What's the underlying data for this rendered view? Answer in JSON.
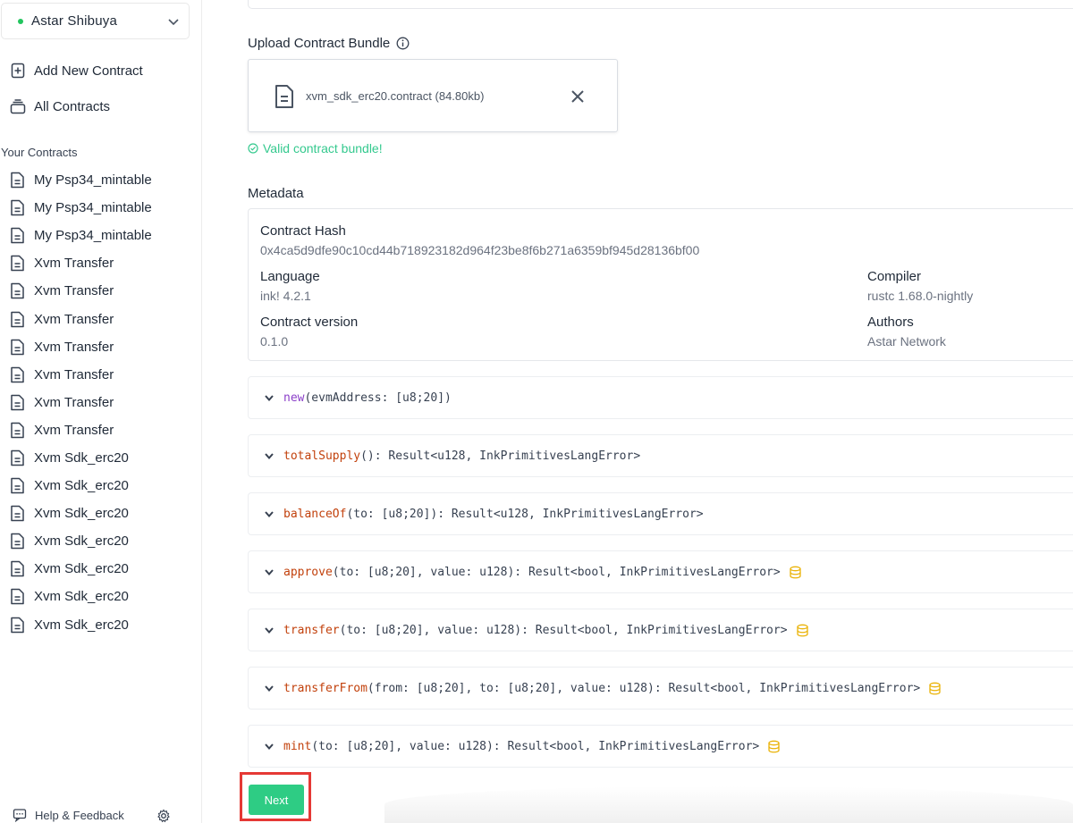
{
  "sidebar": {
    "network": {
      "name": "Astar Shibuya",
      "status_color": "#22c55e"
    },
    "nav": [
      {
        "label": "Add New Contract",
        "icon": "add-file-icon"
      },
      {
        "label": "All Contracts",
        "icon": "stack-icon"
      }
    ],
    "section_title": "Your Contracts",
    "contracts": [
      "My Psp34_mintable",
      "My Psp34_mintable",
      "My Psp34_mintable",
      "Xvm Transfer",
      "Xvm Transfer",
      "Xvm Transfer",
      "Xvm Transfer",
      "Xvm Transfer",
      "Xvm Transfer",
      "Xvm Transfer",
      "Xvm Sdk_erc20",
      "Xvm Sdk_erc20",
      "Xvm Sdk_erc20",
      "Xvm Sdk_erc20",
      "Xvm Sdk_erc20",
      "Xvm Sdk_erc20",
      "Xvm Sdk_erc20"
    ],
    "help_label": "Help & Feedback"
  },
  "upload": {
    "label": "Upload Contract Bundle",
    "file_name": "xvm_sdk_erc20.contract (84.80kb)",
    "valid_text": "Valid contract bundle!"
  },
  "metadata": {
    "label": "Metadata",
    "contract_hash_label": "Contract Hash",
    "contract_hash": "0x4ca5d9dfe90c10cd44b718923182d964f23be8f6b271a6359bf945d28136bf00",
    "language_label": "Language",
    "language": "ink! 4.2.1",
    "compiler_label": "Compiler",
    "compiler": "rustc 1.68.0-nightly",
    "version_label": "Contract version",
    "version": "0.1.0",
    "authors_label": "Authors",
    "authors": "Astar Network"
  },
  "messages": [
    {
      "name": "new",
      "rest": "(evmAddress: [u8;20])",
      "constructor": true,
      "payable": false
    },
    {
      "name": "totalSupply",
      "rest": "(): Result<u128, InkPrimitivesLangError>",
      "constructor": false,
      "payable": false
    },
    {
      "name": "balanceOf",
      "rest": "(to: [u8;20]): Result<u128, InkPrimitivesLangError>",
      "constructor": false,
      "payable": false
    },
    {
      "name": "approve",
      "rest": "(to: [u8;20], value: u128): Result<bool, InkPrimitivesLangError>",
      "constructor": false,
      "payable": true
    },
    {
      "name": "transfer",
      "rest": "(to: [u8;20], value: u128): Result<bool, InkPrimitivesLangError>",
      "constructor": false,
      "payable": true
    },
    {
      "name": "transferFrom",
      "rest": "(from: [u8;20], to: [u8;20], value: u128): Result<bool, InkPrimitivesLangError>",
      "constructor": false,
      "payable": true
    },
    {
      "name": "mint",
      "rest": "(to: [u8;20], value: u128): Result<bool, InkPrimitivesLangError>",
      "constructor": false,
      "payable": true
    }
  ],
  "next_label": "Next",
  "colors": {
    "accent": "#2ecc84",
    "valid": "#34c98e",
    "highlight": "#e53935",
    "fn_name": "#c2410c",
    "ctor_name": "#8b3fc9",
    "coins": "#eab308"
  }
}
